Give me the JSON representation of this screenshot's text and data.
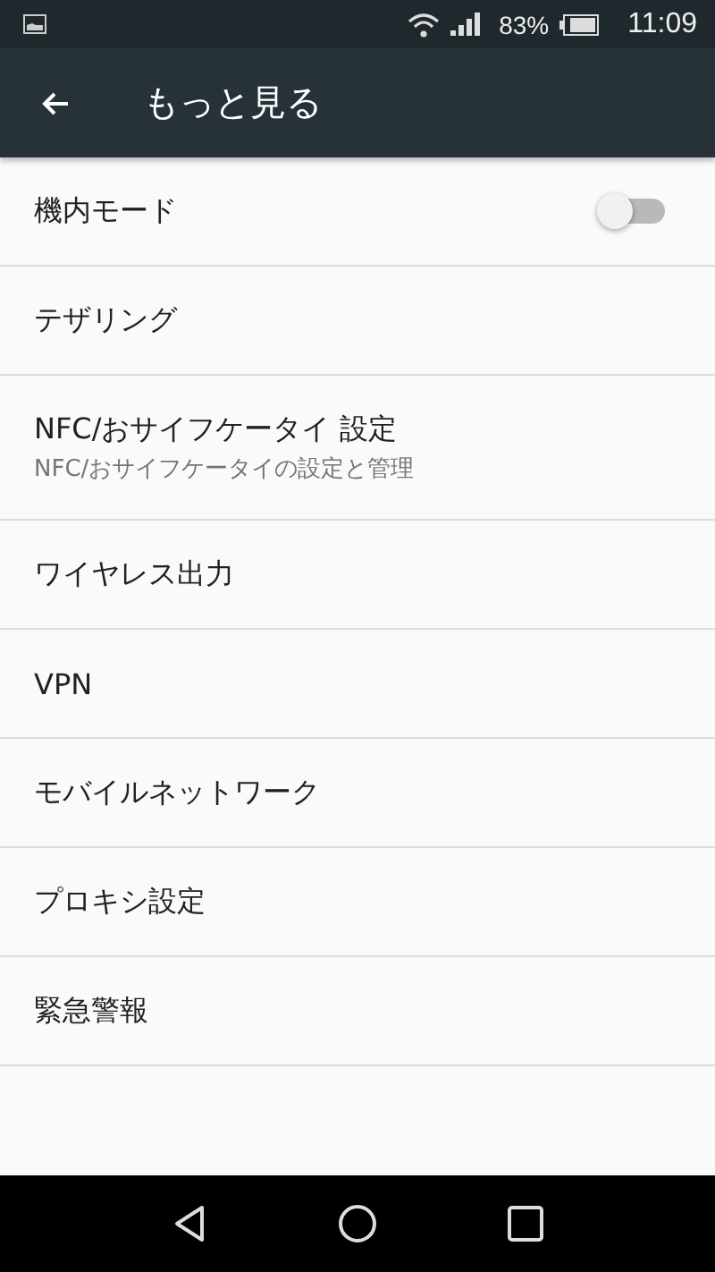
{
  "status_bar": {
    "battery": "83%",
    "time": "11:09"
  },
  "app_bar": {
    "title": "もっと見る"
  },
  "items": [
    {
      "kind": "switch",
      "title": "機内モード",
      "on": false
    },
    {
      "kind": "plain",
      "title": "テザリング"
    },
    {
      "kind": "plain",
      "title": "NFC/おサイフケータイ 設定",
      "summary": "NFC/おサイフケータイの設定と管理"
    },
    {
      "kind": "plain",
      "title": "ワイヤレス出力"
    },
    {
      "kind": "plain",
      "title": "VPN"
    },
    {
      "kind": "plain",
      "title": "モバイルネットワーク"
    },
    {
      "kind": "plain",
      "title": "プロキシ設定"
    },
    {
      "kind": "plain",
      "title": "緊急警報"
    }
  ]
}
